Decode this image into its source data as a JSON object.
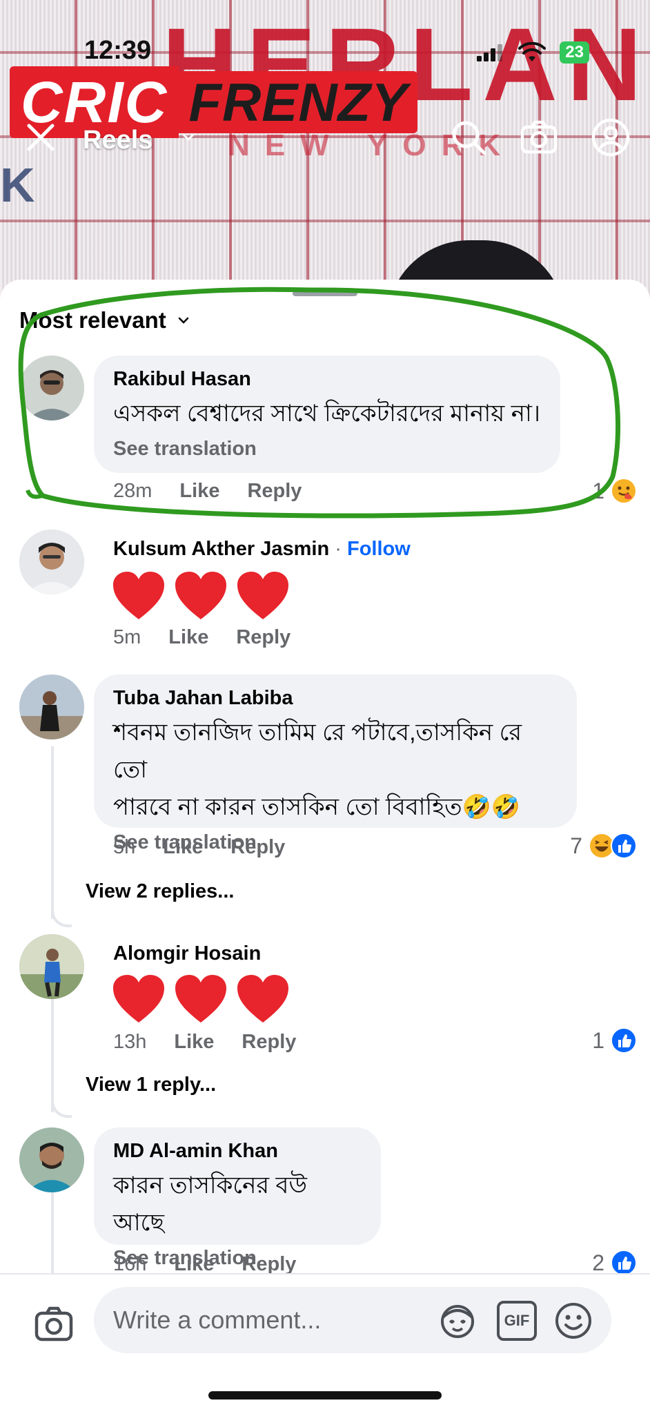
{
  "status_bar": {
    "time": "12:39",
    "battery": "23"
  },
  "background_branding": {
    "text": "HERLAN",
    "sub": "NEW YORK",
    "left_letter": "K"
  },
  "watermark": {
    "part1": "CRIC",
    "part2": "FRENZY"
  },
  "header": {
    "title": "Reels"
  },
  "sheet": {
    "sort_label": "Most relevant"
  },
  "comments": [
    {
      "author": "Rakibul Hasan",
      "text": "এসকল বেশ্বাদের সাথে ক্রিকেটারদের মানায় না।",
      "see_translation": "See translation",
      "time": "28m",
      "like": "Like",
      "reply": "Reply",
      "reaction_count": "1"
    },
    {
      "author": "Kulsum Akther Jasmin",
      "separator": "·",
      "follow": "Follow",
      "time": "5m",
      "like": "Like",
      "reply": "Reply"
    },
    {
      "author": "Tuba Jahan Labiba",
      "text_line1": "শবনম তানজিদ তামিম রে পটাবে,তাসকিন রে তো",
      "text_line2": "পারবে না কারন তাসকিন তো বিবাহিত🤣🤣",
      "see_translation": "See translation",
      "time": "5h",
      "like": "Like",
      "reply": "Reply",
      "reaction_count": "7",
      "view_replies": "View 2 replies..."
    },
    {
      "author": "Alomgir Hosain",
      "time": "13h",
      "like": "Like",
      "reply": "Reply",
      "reaction_count": "1",
      "view_replies": "View 1 reply..."
    },
    {
      "author": "MD Al-amin Khan",
      "text": "কারন তাসকিনের বউ আছে",
      "see_translation": "See translation",
      "time": "16h",
      "like": "Like",
      "reply": "Reply",
      "reaction_count": "2"
    }
  ],
  "composer": {
    "placeholder": "Write a comment...",
    "gif_label": "GIF"
  },
  "colors": {
    "accent": "#0866ff",
    "bubble": "#f0f2f5",
    "highlight": "#2f9a1f",
    "watermark": "#e3202a"
  }
}
